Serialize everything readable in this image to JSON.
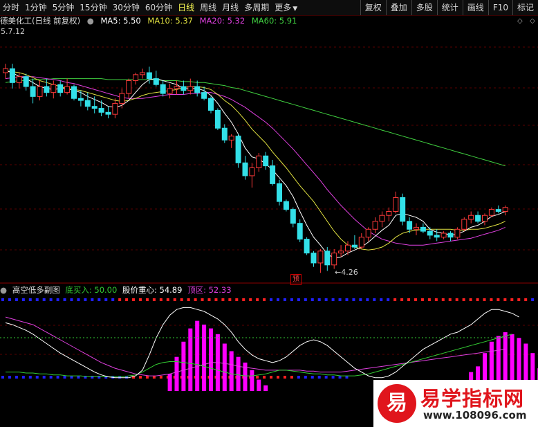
{
  "toolbar": {
    "periods": [
      "分时",
      "1分钟",
      "5分钟",
      "15分钟",
      "30分钟",
      "60分钟",
      "日线",
      "周线",
      "月线",
      "多周期"
    ],
    "active_period": "日线",
    "more_label": "更多",
    "right_buttons": [
      "复权",
      "叠加",
      "多股",
      "统计",
      "画线",
      "F10",
      "标记"
    ]
  },
  "stock": {
    "title": "德美化工(日线 前复权)",
    "ma5": "MA5: 5.50",
    "ma10": "MA10: 5.37",
    "ma20": "MA20: 5.32",
    "ma60": "MA60: 5.91",
    "ma_prev_label": "5.7.12",
    "low_label": "4.26",
    "forecast_tag": "预",
    "colors": {
      "up": "#ff3a3a",
      "down": "#33e0e8",
      "ma5": "#ffffff",
      "ma10": "#e0e040",
      "ma20": "#e040e0",
      "ma60": "#40d040"
    }
  },
  "indicator": {
    "name": "高空低多副图",
    "buy_label": "底买入: 50.00",
    "center_label": "股价重心: 54.89",
    "top_label": "顶区: 52.33",
    "colors": {
      "buy": "#33cc33",
      "center": "#ffffff",
      "top": "#e040e0"
    }
  },
  "watermark": {
    "logo": "易",
    "title": "易学指标网",
    "url": "www.108096.com"
  },
  "chart_data": {
    "type": "candlestick",
    "price_range": [
      4.26,
      6.3
    ],
    "candles": [
      [
        5.86,
        5.95,
        5.8,
        5.9
      ],
      [
        5.9,
        5.95,
        5.7,
        5.76
      ],
      [
        5.76,
        5.86,
        5.7,
        5.82
      ],
      [
        5.82,
        5.85,
        5.68,
        5.72
      ],
      [
        5.72,
        5.8,
        5.55,
        5.62
      ],
      [
        5.62,
        5.78,
        5.58,
        5.72
      ],
      [
        5.72,
        5.8,
        5.62,
        5.66
      ],
      [
        5.66,
        5.78,
        5.6,
        5.74
      ],
      [
        5.74,
        5.78,
        5.62,
        5.66
      ],
      [
        5.66,
        5.8,
        5.64,
        5.72
      ],
      [
        5.72,
        5.74,
        5.58,
        5.6
      ],
      [
        5.6,
        5.68,
        5.52,
        5.58
      ],
      [
        5.58,
        5.66,
        5.48,
        5.52
      ],
      [
        5.52,
        5.62,
        5.45,
        5.5
      ],
      [
        5.5,
        5.58,
        5.42,
        5.46
      ],
      [
        5.46,
        5.52,
        5.4,
        5.44
      ],
      [
        5.44,
        5.6,
        5.4,
        5.55
      ],
      [
        5.55,
        5.7,
        5.5,
        5.65
      ],
      [
        5.65,
        5.8,
        5.6,
        5.78
      ],
      [
        5.78,
        5.86,
        5.74,
        5.84
      ],
      [
        5.84,
        5.9,
        5.8,
        5.86
      ],
      [
        5.86,
        5.92,
        5.75,
        5.8
      ],
      [
        5.8,
        5.88,
        5.72,
        5.74
      ],
      [
        5.74,
        5.78,
        5.62,
        5.65
      ],
      [
        5.65,
        5.75,
        5.6,
        5.7
      ],
      [
        5.7,
        5.78,
        5.64,
        5.72
      ],
      [
        5.72,
        5.78,
        5.64,
        5.68
      ],
      [
        5.68,
        5.8,
        5.64,
        5.72
      ],
      [
        5.72,
        5.78,
        5.62,
        5.66
      ],
      [
        5.66,
        5.72,
        5.58,
        5.6
      ],
      [
        5.6,
        5.62,
        5.45,
        5.48
      ],
      [
        5.48,
        5.5,
        5.28,
        5.3
      ],
      [
        5.3,
        5.34,
        5.15,
        5.18
      ],
      [
        5.18,
        5.24,
        5.1,
        5.22
      ],
      [
        5.22,
        5.24,
        4.9,
        4.95
      ],
      [
        4.95,
        5.02,
        4.78,
        4.82
      ],
      [
        4.82,
        4.95,
        4.7,
        4.9
      ],
      [
        4.9,
        5.05,
        4.86,
        5.02
      ],
      [
        5.02,
        5.06,
        4.88,
        4.92
      ],
      [
        4.92,
        4.98,
        4.72,
        4.74
      ],
      [
        4.74,
        4.78,
        4.52,
        4.56
      ],
      [
        4.56,
        4.58,
        4.46,
        4.48
      ],
      [
        4.48,
        4.5,
        4.3,
        4.34
      ],
      [
        4.34,
        4.38,
        4.15,
        4.18
      ],
      [
        4.18,
        4.2,
        4.02,
        4.04
      ],
      [
        4.04,
        4.06,
        3.9,
        3.94
      ],
      [
        3.94,
        4.08,
        3.84,
        4.06
      ],
      [
        4.06,
        4.1,
        3.86,
        3.92
      ],
      [
        3.92,
        4.08,
        3.88,
        4.04
      ],
      [
        4.04,
        4.12,
        4.0,
        4.06
      ],
      [
        4.06,
        4.16,
        4.02,
        4.12
      ],
      [
        4.12,
        4.22,
        4.08,
        4.1
      ],
      [
        4.1,
        4.24,
        4.08,
        4.2
      ],
      [
        4.2,
        4.3,
        4.16,
        4.28
      ],
      [
        4.28,
        4.4,
        4.24,
        4.36
      ],
      [
        4.36,
        4.46,
        4.3,
        4.42
      ],
      [
        4.42,
        4.5,
        4.36,
        4.46
      ],
      [
        4.46,
        4.66,
        4.44,
        4.6
      ],
      [
        4.6,
        4.64,
        4.32,
        4.36
      ],
      [
        4.36,
        4.4,
        4.24,
        4.28
      ],
      [
        4.28,
        4.34,
        4.22,
        4.3
      ],
      [
        4.3,
        4.34,
        4.24,
        4.26
      ],
      [
        4.26,
        4.3,
        4.18,
        4.22
      ],
      [
        4.22,
        4.28,
        4.16,
        4.2
      ],
      [
        4.2,
        4.26,
        4.18,
        4.24
      ],
      [
        4.24,
        4.26,
        4.16,
        4.2
      ],
      [
        4.2,
        4.3,
        4.18,
        4.28
      ],
      [
        4.28,
        4.4,
        4.26,
        4.38
      ],
      [
        4.38,
        4.46,
        4.34,
        4.42
      ],
      [
        4.42,
        4.46,
        4.34,
        4.36
      ],
      [
        4.36,
        4.44,
        4.32,
        4.42
      ],
      [
        4.42,
        4.5,
        4.4,
        4.48
      ],
      [
        4.48,
        4.52,
        4.44,
        4.46
      ],
      [
        4.46,
        4.52,
        4.42,
        4.5
      ]
    ],
    "ma5": [
      5.88,
      5.86,
      5.82,
      5.8,
      5.76,
      5.72,
      5.7,
      5.69,
      5.7,
      5.7,
      5.68,
      5.66,
      5.62,
      5.59,
      5.56,
      5.52,
      5.51,
      5.53,
      5.58,
      5.66,
      5.74,
      5.79,
      5.8,
      5.78,
      5.76,
      5.74,
      5.7,
      5.7,
      5.7,
      5.68,
      5.63,
      5.55,
      5.45,
      5.36,
      5.24,
      5.1,
      5.01,
      4.99,
      4.94,
      4.88,
      4.8,
      4.72,
      4.61,
      4.46,
      4.32,
      4.2,
      4.12,
      4.03,
      3.99,
      4.0,
      4.04,
      4.07,
      4.1,
      4.15,
      4.21,
      4.27,
      4.32,
      4.42,
      4.44,
      4.42,
      4.4,
      4.36,
      4.28,
      4.25,
      4.24,
      4.22,
      4.23,
      4.26,
      4.3,
      4.32,
      4.36,
      4.41,
      4.43,
      4.46
    ],
    "ma10": [
      5.88,
      5.87,
      5.86,
      5.84,
      5.81,
      5.78,
      5.76,
      5.74,
      5.72,
      5.7,
      5.69,
      5.68,
      5.66,
      5.64,
      5.62,
      5.6,
      5.58,
      5.57,
      5.58,
      5.6,
      5.63,
      5.65,
      5.66,
      5.67,
      5.68,
      5.69,
      5.71,
      5.72,
      5.72,
      5.71,
      5.69,
      5.64,
      5.58,
      5.53,
      5.46,
      5.38,
      5.29,
      5.22,
      5.15,
      5.06,
      4.98,
      4.9,
      4.81,
      4.72,
      4.64,
      4.56,
      4.46,
      4.36,
      4.26,
      4.18,
      4.12,
      4.1,
      4.08,
      4.07,
      4.08,
      4.1,
      4.14,
      4.2,
      4.24,
      4.26,
      4.27,
      4.28,
      4.28,
      4.28,
      4.28,
      4.28,
      4.27,
      4.27,
      4.28,
      4.28,
      4.29,
      4.31,
      4.33,
      4.36
    ],
    "ma20": [
      5.8,
      5.81,
      5.82,
      5.82,
      5.82,
      5.81,
      5.8,
      5.79,
      5.78,
      5.76,
      5.75,
      5.73,
      5.71,
      5.69,
      5.67,
      5.65,
      5.63,
      5.61,
      5.6,
      5.6,
      5.6,
      5.61,
      5.62,
      5.63,
      5.64,
      5.64,
      5.64,
      5.65,
      5.65,
      5.66,
      5.66,
      5.64,
      5.62,
      5.59,
      5.55,
      5.51,
      5.46,
      5.41,
      5.36,
      5.3,
      5.23,
      5.16,
      5.09,
      5.01,
      4.93,
      4.85,
      4.77,
      4.68,
      4.6,
      4.52,
      4.45,
      4.38,
      4.32,
      4.26,
      4.22,
      4.18,
      4.16,
      4.14,
      4.13,
      4.12,
      4.12,
      4.12,
      4.13,
      4.14,
      4.15,
      4.16,
      4.17,
      4.18,
      4.19,
      4.21,
      4.23,
      4.25,
      4.27,
      4.3
    ],
    "ma60": [
      5.76,
      5.77,
      5.78,
      5.78,
      5.79,
      5.79,
      5.79,
      5.8,
      5.8,
      5.8,
      5.8,
      5.8,
      5.8,
      5.8,
      5.8,
      5.79,
      5.79,
      5.79,
      5.79,
      5.79,
      5.79,
      5.79,
      5.79,
      5.78,
      5.78,
      5.78,
      5.77,
      5.77,
      5.76,
      5.76,
      5.75,
      5.74,
      5.73,
      5.71,
      5.7,
      5.68,
      5.66,
      5.64,
      5.62,
      5.6,
      5.58,
      5.56,
      5.54,
      5.52,
      5.5,
      5.48,
      5.46,
      5.44,
      5.42,
      5.4,
      5.38,
      5.36,
      5.34,
      5.32,
      5.3,
      5.28,
      5.26,
      5.24,
      5.22,
      5.2,
      5.18,
      5.16,
      5.14,
      5.12,
      5.1,
      5.08,
      5.06,
      5.04,
      5.02,
      5.0,
      4.98,
      4.96,
      4.94,
      4.92
    ],
    "bars_magenta": [
      0,
      0,
      0,
      0,
      0,
      0,
      0,
      0,
      0,
      0,
      0,
      0,
      0,
      0,
      0,
      0,
      0,
      0,
      0,
      0,
      0,
      0,
      0,
      0,
      18,
      36,
      52,
      66,
      74,
      70,
      66,
      60,
      50,
      42,
      36,
      30,
      22,
      12,
      6,
      0,
      0,
      0,
      0,
      0,
      0,
      0,
      0,
      0,
      0,
      0,
      0,
      0,
      0,
      0,
      0,
      0,
      0,
      0,
      0,
      0,
      0,
      0,
      0,
      0,
      0,
      0,
      0,
      0,
      20,
      26,
      40,
      52,
      58,
      62,
      60,
      56,
      50,
      40,
      24,
      8
    ],
    "center_line": [
      72,
      70,
      67,
      64,
      60,
      55,
      50,
      45,
      40,
      36,
      32,
      28,
      24,
      20,
      17,
      15,
      14,
      14,
      14,
      16,
      22,
      38,
      56,
      70,
      80,
      86,
      88,
      88,
      86,
      84,
      80,
      76,
      70,
      62,
      52,
      44,
      38,
      34,
      32,
      30,
      32,
      36,
      42,
      48,
      52,
      54,
      52,
      48,
      42,
      36,
      30,
      24,
      20,
      16,
      14,
      14,
      16,
      20,
      26,
      32,
      38,
      44,
      48,
      52,
      56,
      60,
      62,
      66,
      70,
      76,
      82,
      86,
      86,
      84,
      82,
      78
    ],
    "buy_line": [
      20,
      20,
      20,
      19,
      19,
      18,
      18,
      17,
      17,
      16,
      16,
      16,
      15,
      15,
      15,
      15,
      15,
      15,
      16,
      17,
      20,
      24,
      28,
      30,
      31,
      31,
      30,
      29,
      28,
      26,
      24,
      22,
      20,
      18,
      17,
      16,
      16,
      17,
      18,
      20,
      22,
      22,
      21,
      20,
      19,
      18,
      18,
      17,
      17,
      16,
      16,
      16,
      17,
      18,
      20,
      22,
      24,
      26,
      28,
      30,
      32,
      34,
      36,
      38,
      40,
      42,
      44,
      46,
      48,
      50,
      52,
      54,
      56,
      58,
      60
    ],
    "top_line": [
      78,
      76,
      74,
      72,
      70,
      66,
      62,
      58,
      54,
      50,
      46,
      42,
      38,
      34,
      30,
      27,
      24,
      22,
      20,
      18,
      17,
      16,
      16,
      17,
      18,
      20,
      22,
      24,
      26,
      28,
      30,
      30,
      29,
      28,
      26,
      25,
      24,
      23,
      22,
      22,
      22,
      22,
      22,
      22,
      21,
      21,
      20,
      20,
      20,
      20,
      21,
      22,
      23,
      24,
      25,
      26,
      27,
      28,
      29,
      30,
      31,
      32,
      33,
      34,
      35,
      36,
      37,
      38,
      39,
      40,
      41,
      42,
      43,
      44
    ]
  }
}
